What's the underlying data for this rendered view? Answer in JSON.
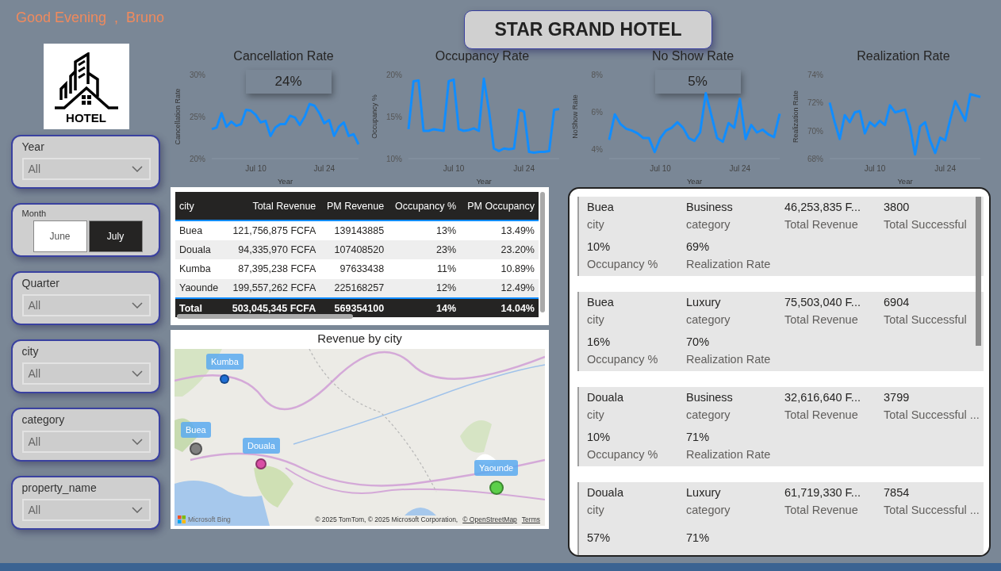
{
  "greeting": "Good Evening  ,  Bruno",
  "title": "STAR GRAND HOTEL",
  "logo": {
    "text": "HOTEL"
  },
  "slicers": [
    {
      "kind": "dropdown",
      "label": "Year",
      "value": "All"
    },
    {
      "kind": "buttons",
      "label": "Month",
      "options": [
        {
          "label": "June",
          "selected": false
        },
        {
          "label": "July",
          "selected": true
        }
      ]
    },
    {
      "kind": "dropdown",
      "label": "Quarter",
      "value": "All"
    },
    {
      "kind": "dropdown",
      "label": "city",
      "value": "All"
    },
    {
      "kind": "dropdown",
      "label": "category",
      "value": "All"
    },
    {
      "kind": "dropdown",
      "label": "property_name",
      "value": "All"
    }
  ],
  "charts": [
    {
      "card_value": "24%",
      "chart_data": {
        "type": "line",
        "title": "Cancellation Rate",
        "xlabel": "Year",
        "ylabel": "Cancellation Rate",
        "categories": [
          null,
          null,
          null,
          null,
          null,
          null,
          null,
          null,
          null,
          "Jul 10",
          null,
          null,
          null,
          null,
          null,
          null,
          null,
          null,
          null,
          null,
          null,
          null,
          null,
          "Jul 24",
          null,
          null,
          null,
          null,
          null,
          null,
          null
        ],
        "ylim": [
          20,
          30
        ],
        "yticks": [
          {
            "value": 20,
            "label": "20%"
          },
          {
            "value": 25,
            "label": "25%"
          },
          {
            "value": 30,
            "label": "30%"
          }
        ],
        "series": [
          {
            "color": "#118dff",
            "values": [
              23.5,
              23.7,
              25.4,
              23.8,
              24.4,
              23.9,
              24.1,
              25.8,
              25.7,
              25.2,
              24.3,
              24.5,
              22.7,
              23.7,
              24.1,
              24.1,
              25.1,
              24.9,
              24.0,
              25.0,
              26.5,
              26.3,
              25.4,
              24.2,
              24.6,
              22.7,
              23.8,
              24.3,
              22.7,
              22.9,
              21.7
            ]
          }
        ]
      }
    },
    {
      "chart_data": {
        "type": "line",
        "title": "Occupancy Rate",
        "xlabel": "Year",
        "ylabel": "Occupancy %",
        "categories": [
          null,
          null,
          null,
          null,
          null,
          null,
          null,
          null,
          null,
          "Jul 10",
          null,
          null,
          null,
          null,
          null,
          null,
          null,
          null,
          null,
          null,
          null,
          null,
          null,
          "Jul 24",
          null,
          null,
          null,
          null,
          null,
          null,
          null
        ],
        "ylim": [
          10,
          20
        ],
        "yticks": [
          {
            "value": 10,
            "label": "10%"
          },
          {
            "value": 15,
            "label": "15%"
          },
          {
            "value": 20,
            "label": "20%"
          }
        ],
        "series": [
          {
            "color": "#118dff",
            "values": [
              13.5,
              19.2,
              19.3,
              13.3,
              13.3,
              13.5,
              13.4,
              13.3,
              19.2,
              19.4,
              13.5,
              13.3,
              13.4,
              13.6,
              13.3,
              19.5,
              15.8,
              11.2,
              10.9,
              11.2,
              11.1,
              11.2,
              15.8,
              15.6,
              10.8,
              10.7,
              10.8,
              10.8,
              10.9,
              15.8,
              15.9
            ]
          }
        ]
      }
    },
    {
      "card_value": "5%",
      "chart_data": {
        "type": "line",
        "title": "No Show Rate",
        "xlabel": "Year",
        "ylabel": "NoShow Rate",
        "categories": [
          null,
          null,
          null,
          null,
          null,
          null,
          null,
          null,
          null,
          "Jul 10",
          null,
          null,
          null,
          null,
          null,
          null,
          null,
          null,
          null,
          null,
          null,
          null,
          null,
          "Jul 24",
          null,
          null,
          null,
          null,
          null,
          null,
          null
        ],
        "ylim": [
          3.5,
          8
        ],
        "yticks": [
          {
            "value": 4,
            "label": "4%"
          },
          {
            "value": 6,
            "label": "6%"
          },
          {
            "value": 8,
            "label": "8%"
          }
        ],
        "series": [
          {
            "color": "#118dff",
            "values": [
              4.5,
              5.87,
              5.35,
              5.1,
              5.0,
              4.85,
              4.6,
              4.6,
              3.85,
              4.6,
              5.0,
              5.15,
              5.45,
              5.15,
              4.6,
              4.45,
              4.9,
              7.0,
              5.8,
              4.6,
              4.4,
              5.4,
              5.15,
              6.7,
              4.55,
              5.3,
              4.9,
              5.05,
              4.8,
              4.65,
              5.9
            ]
          }
        ]
      }
    },
    {
      "chart_data": {
        "type": "line",
        "title": "Realization Rate",
        "xlabel": "Year",
        "ylabel": "Realization Rate",
        "categories": [
          null,
          null,
          null,
          null,
          null,
          null,
          null,
          null,
          null,
          "Jul 10",
          null,
          null,
          null,
          null,
          null,
          null,
          null,
          null,
          null,
          null,
          null,
          null,
          null,
          "Jul 24",
          null,
          null,
          null,
          null,
          null,
          null,
          null
        ],
        "ylim": [
          68,
          74
        ],
        "yticks": [
          {
            "value": 68,
            "label": "68%"
          },
          {
            "value": 70,
            "label": "70%"
          },
          {
            "value": 72,
            "label": "72%"
          },
          {
            "value": 74,
            "label": "74%"
          }
        ],
        "series": [
          {
            "color": "#118dff",
            "values": [
              72.0,
              70.6,
              69.4,
              71.1,
              70.6,
              71.3,
              71.4,
              69.8,
              70.6,
              70.3,
              70.7,
              70.4,
              71.8,
              71.3,
              71.4,
              71.5,
              70.3,
              68.3,
              70.3,
              70.6,
              69.3,
              68.4,
              69.5,
              69.3,
              70.8,
              72.1,
              71.4,
              70.7,
              72.6,
              72.5,
              72.4
            ]
          }
        ]
      }
    }
  ],
  "table": {
    "columns": [
      "city",
      "Total Revenue",
      "PM Revenue",
      "Occupancy %",
      "PM Occupancy"
    ],
    "rows": [
      [
        "Buea",
        "121,756,875 FCFA",
        "139143885",
        "13%",
        "13.49%"
      ],
      [
        "Douala",
        "94,335,970 FCFA",
        "107408520",
        "23%",
        "23.20%"
      ],
      [
        "Kumba",
        "87,395,238 FCFA",
        "97633438",
        "11%",
        "10.89%"
      ],
      [
        "Yaounde",
        "199,557,262 FCFA",
        "225168257",
        "12%",
        "12.49%"
      ]
    ],
    "total": [
      "Total",
      "503,045,345 FCFA",
      "569354100",
      "14%",
      "14.04%"
    ]
  },
  "map": {
    "title": "Revenue by city",
    "kind": "picture",
    "markers": [
      {
        "label": "Kumba",
        "color": "#1f6fd6"
      },
      {
        "label": "Buea",
        "color": "#808080"
      },
      {
        "label": "Douala",
        "color": "#d94fa5"
      },
      {
        "label": "Yaounde",
        "color": "#5ccf4a"
      }
    ],
    "brand": "Microsoft Bing",
    "attribution": "© 2025 TomTom, © 2025 Microsoft Corporation,",
    "osm_link": "© OpenStreetMap",
    "terms_link": "Terms"
  },
  "cards": [
    {
      "fields": [
        {
          "value": "Buea",
          "label": "city"
        },
        {
          "value": "Business",
          "label": "category"
        },
        {
          "value": "46,253,835 F...",
          "label": "Total Revenue"
        },
        {
          "value": "3800",
          "label": "Total Successful"
        },
        {
          "value": "10%",
          "label": "Occupancy %"
        },
        {
          "value": "69%",
          "label": "Realization Rate"
        }
      ]
    },
    {
      "fields": [
        {
          "value": "Buea",
          "label": "city"
        },
        {
          "value": "Luxury",
          "label": "category"
        },
        {
          "value": "75,503,040 F...",
          "label": "Total Revenue"
        },
        {
          "value": "6904",
          "label": "Total Successful"
        },
        {
          "value": "16%",
          "label": "Occupancy %"
        },
        {
          "value": "70%",
          "label": "Realization Rate"
        }
      ]
    },
    {
      "fields": [
        {
          "value": "Douala",
          "label": "city"
        },
        {
          "value": "Business",
          "label": "category"
        },
        {
          "value": "32,616,640 F...",
          "label": "Total Revenue"
        },
        {
          "value": "3799",
          "label": "Total Successful ..."
        },
        {
          "value": "10%",
          "label": "Occupancy %"
        },
        {
          "value": "71%",
          "label": "Realization Rate"
        }
      ]
    },
    {
      "fields": [
        {
          "value": "Douala",
          "label": "city"
        },
        {
          "value": "Luxury",
          "label": "category"
        },
        {
          "value": "61,719,330 F...",
          "label": "Total Revenue"
        },
        {
          "value": "7854",
          "label": "Total Successful ..."
        },
        {
          "value": "57%"
        },
        {
          "value": "71%"
        }
      ]
    }
  ]
}
